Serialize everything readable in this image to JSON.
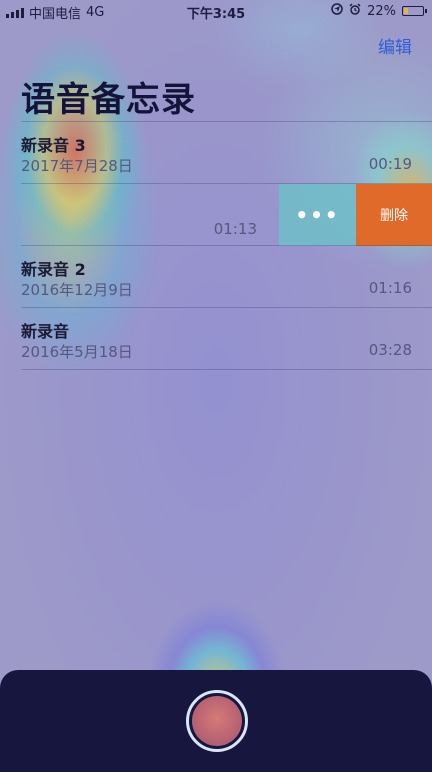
{
  "status_bar": {
    "carrier": "中国电信",
    "network": "4G",
    "time": "下午3:45",
    "battery_percent": "22%",
    "battery_level": 0.22,
    "icons": [
      "signal-icon",
      "location-icon",
      "alarm-icon",
      "battery-icon"
    ]
  },
  "nav": {
    "edit_label": "编辑",
    "title": "语音备忘录"
  },
  "recordings": [
    {
      "title": "新录音 3",
      "date": "2017年7月28日",
      "duration": "00:19"
    },
    {
      "title": "",
      "date": "",
      "duration": "01:13",
      "swiped": true
    },
    {
      "title": "新录音 2",
      "date": "2016年12月9日",
      "duration": "01:16"
    },
    {
      "title": "新录音",
      "date": "2016年5月18日",
      "duration": "03:28"
    }
  ],
  "swipe_actions": {
    "more_label": "•••",
    "delete_label": "删除"
  },
  "colors": {
    "accent": "#2f5ed8",
    "delete": "#e06a2a",
    "more": "#6ebec8",
    "panel": "#16163f"
  }
}
